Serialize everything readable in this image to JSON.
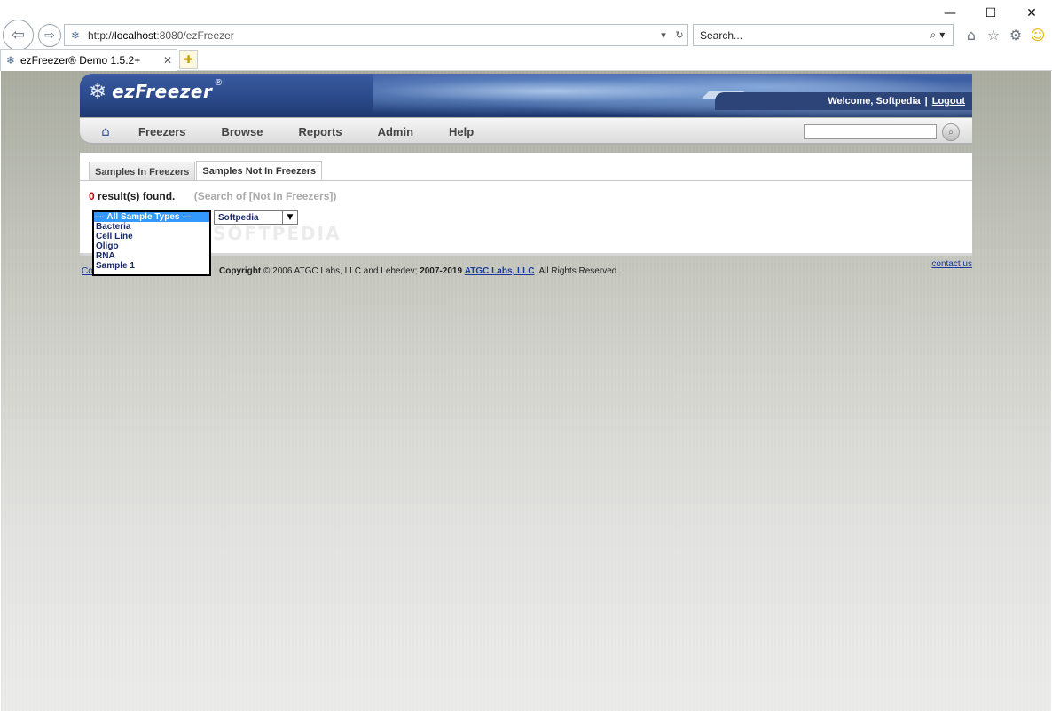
{
  "browser": {
    "window_controls": {
      "minimize": "—",
      "maximize": "☐",
      "close": "✕"
    },
    "address": {
      "scheme": "http://",
      "host": "localhost",
      "rest": ":8080/ezFreezer"
    },
    "search": {
      "placeholder": "Search..."
    },
    "tab": {
      "title": "ezFreezer® Demo 1.5.2+"
    },
    "icons": [
      "back-icon",
      "forward-icon",
      "site-icon",
      "dropdown-icon",
      "refresh-icon",
      "search-icon",
      "home-icon",
      "favorites-icon",
      "settings-icon",
      "smiley-icon",
      "new-tab-icon"
    ]
  },
  "app": {
    "logo": {
      "text": "ezFreezer",
      "reg": "®"
    },
    "welcome": {
      "text": "Welcome, Softpedia",
      "separator": "|",
      "logout": "Logout"
    },
    "nav": {
      "items": [
        "Freezers",
        "Browse",
        "Reports",
        "Admin",
        "Help"
      ]
    },
    "tabs": [
      {
        "label": "Samples In Freezers",
        "active": false
      },
      {
        "label": "Samples Not In Freezers",
        "active": true
      }
    ],
    "results": {
      "count": "0",
      "label": "result(s) found.",
      "scope": "(Search of [Not In Freezers])"
    },
    "sample_types": {
      "options": [
        "--- All Sample Types ---",
        "Bacteria",
        "Cell Line",
        "Oligo",
        "RNA",
        "Sample 1"
      ],
      "selected": "--- All Sample Types ---"
    },
    "owner": {
      "selected": "Softpedia"
    },
    "watermark": "SOFTPEDIA",
    "footer": {
      "left_link": "Co",
      "copyright_label": "Copyright",
      "copyright_rest": " © 2006 ATGC Labs, LLC and Lebedev; ",
      "years": "2007-2019",
      "company_link": "ATGC Labs, LLC",
      "rights": ". All Rights Reserved.",
      "contact": "contact us"
    },
    "colors": {
      "header_blue": "#2b4a8a",
      "result_count": "#c00000",
      "link": "#1a3aa0",
      "selected_option": "#3399ff"
    }
  }
}
